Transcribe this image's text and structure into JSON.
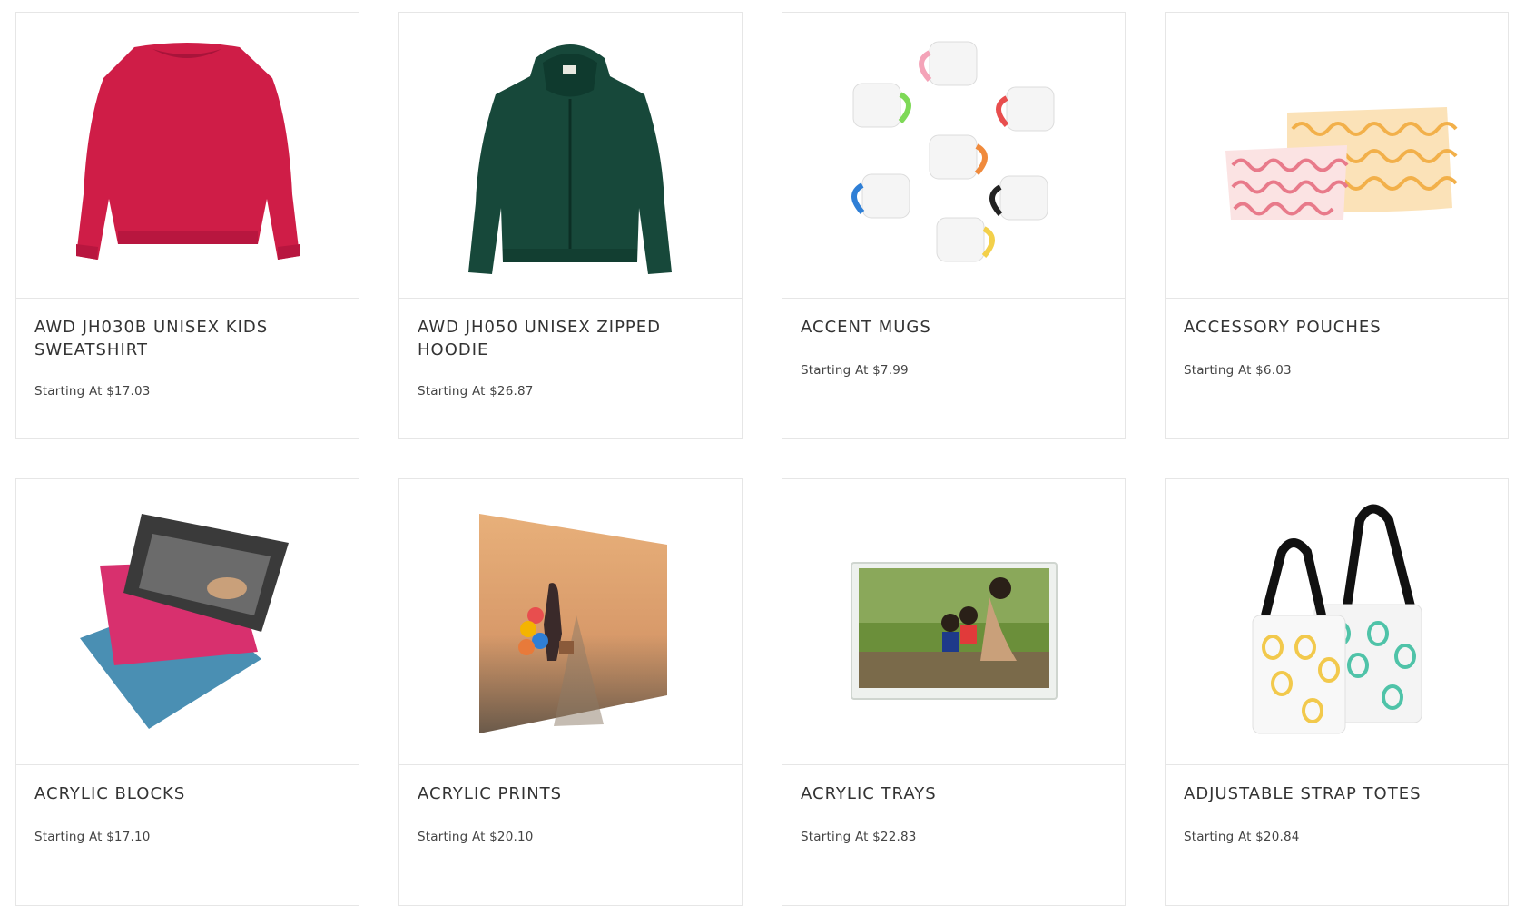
{
  "products": [
    {
      "title": "AWD JH030B UNISEX KIDS SWEATSHIRT",
      "price_prefix": "Starting At",
      "price": "$17.03",
      "image": "red-sweatshirt"
    },
    {
      "title": "AWD JH050 UNISEX ZIPPED HOODIE",
      "price_prefix": "Starting At",
      "price": "$26.87",
      "image": "green-zip-hoodie"
    },
    {
      "title": "ACCENT MUGS",
      "price_prefix": "Starting At",
      "price": "$7.99",
      "image": "accent-mugs"
    },
    {
      "title": "ACCESSORY POUCHES",
      "price_prefix": "Starting At",
      "price": "$6.03",
      "image": "accessory-pouches"
    },
    {
      "title": "ACRYLIC BLOCKS",
      "price_prefix": "Starting At",
      "price": "$17.10",
      "image": "acrylic-blocks"
    },
    {
      "title": "ACRYLIC PRINTS",
      "price_prefix": "Starting At",
      "price": "$20.10",
      "image": "acrylic-print"
    },
    {
      "title": "ACRYLIC TRAYS",
      "price_prefix": "Starting At",
      "price": "$22.83",
      "image": "acrylic-tray"
    },
    {
      "title": "ADJUSTABLE STRAP TOTES",
      "price_prefix": "Starting At",
      "price": "$20.84",
      "image": "strap-totes"
    }
  ]
}
